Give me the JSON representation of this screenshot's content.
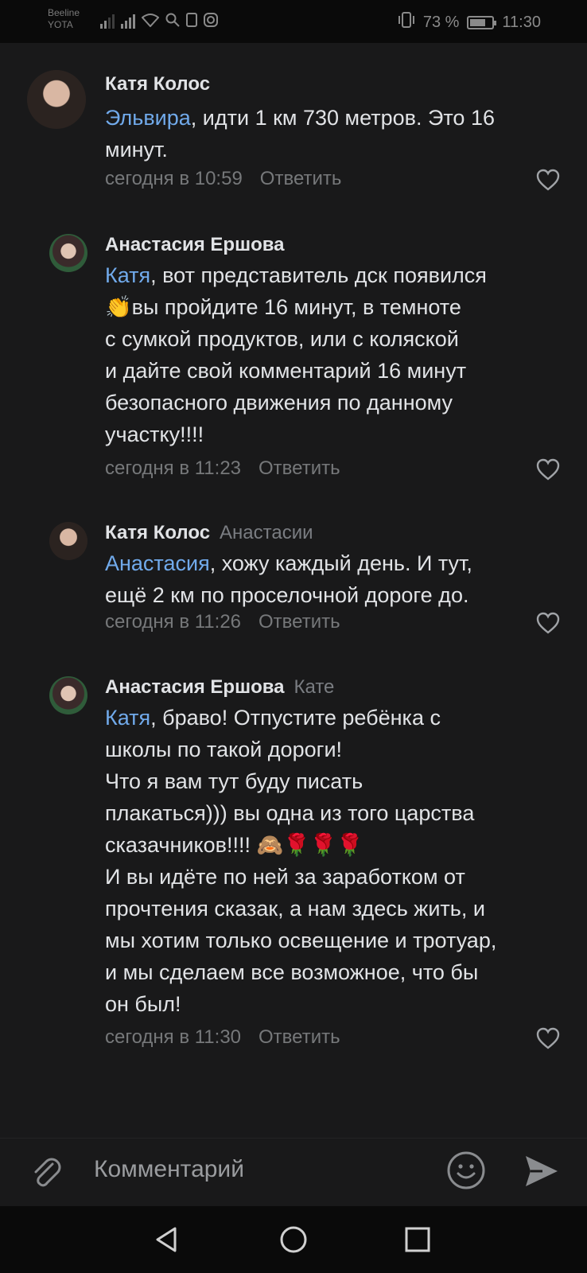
{
  "status_bar": {
    "carrier_1": "Beeline",
    "carrier_2": "YOTA",
    "battery": "73 %",
    "battery_level": 0.73,
    "time": "11:30"
  },
  "comments": [
    {
      "author": "Катя Колос",
      "reply_to": "",
      "text_lines": [
        {
          "mention": "Эльвира",
          "rest": ", идти 1 км 730 метров. Это 16"
        },
        {
          "mention": "",
          "rest": "минут."
        }
      ],
      "time": "сегодня в 10:59",
      "reply_label": "Ответить"
    },
    {
      "author": "Анастасия Ершова",
      "reply_to": "",
      "text_lines": [
        {
          "mention": "Катя",
          "rest": ", вот представитель дск появился"
        },
        {
          "mention": "",
          "rest": "👏вы пройдите 16 минут, в темноте"
        },
        {
          "mention": "",
          "rest": "с сумкой продуктов, или с коляской"
        },
        {
          "mention": "",
          "rest": "и дайте свой комментарий 16 минут"
        },
        {
          "mention": "",
          "rest": "безопасного движения по данному"
        },
        {
          "mention": "",
          "rest": "участку!!!!"
        }
      ],
      "time": "сегодня в 11:23",
      "reply_label": "Ответить"
    },
    {
      "author": "Катя Колос",
      "reply_to": "Анастасии",
      "text_lines": [
        {
          "mention": "Анастасия",
          "rest": ", хожу каждый день. И тут,"
        },
        {
          "mention": "",
          "rest": "ещё 2 км по проселочной дороге до."
        }
      ],
      "time": "сегодня в 11:26",
      "reply_label": "Ответить"
    },
    {
      "author": "Анастасия Ершова",
      "reply_to": "Кате",
      "text_lines": [
        {
          "mention": "Катя",
          "rest": ", браво! Отпустите ребёнка с"
        },
        {
          "mention": "",
          "rest": "школы по такой дороги!"
        },
        {
          "mention": "",
          "rest": "Что я вам тут буду писать"
        },
        {
          "mention": "",
          "rest": "плакаться))) вы одна из того царства"
        },
        {
          "mention": "",
          "rest": "сказачников!!!! 🙈🌹🌹🌹"
        },
        {
          "mention": "",
          "rest": "И вы идёте по ней за заработком от"
        },
        {
          "mention": "",
          "rest": "прочтения сказак, а нам здесь жить, и"
        },
        {
          "mention": "",
          "rest": "мы хотим только освещение и тротуар,"
        },
        {
          "mention": "",
          "rest": "и мы сделаем все возможное, что бы"
        },
        {
          "mention": "",
          "rest": "он был!"
        }
      ],
      "time": "сегодня в 11:30",
      "reply_label": "Ответить"
    }
  ],
  "composer": {
    "placeholder": "Комментарий",
    "attach_icon": "paperclip-icon",
    "emoji_icon": "smile-icon",
    "send_icon": "send-icon"
  },
  "navbar": {
    "back_icon": "back-triangle-icon",
    "home_icon": "home-circle-icon",
    "recents_icon": "recents-square-icon"
  },
  "colors": {
    "background": "#19191a",
    "mention": "#71aaeb",
    "secondary_text": "#76787a"
  }
}
